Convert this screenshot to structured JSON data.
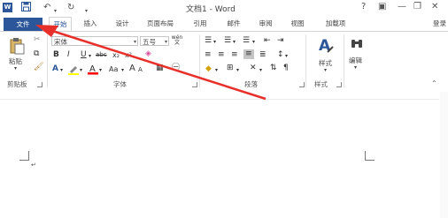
{
  "app": {
    "logo": "W",
    "title": "文档1 - Word"
  },
  "quick_access": {
    "save_icon": "save-icon",
    "undo_icon": "undo-icon",
    "redo_icon": "redo-icon",
    "customize_icon": "customize-qat-icon"
  },
  "window_controls": {
    "help": "?",
    "ribbon_display": "▣",
    "minimize": "—",
    "restore": "❐",
    "close": "✕"
  },
  "tabs": [
    {
      "label": "文件"
    },
    {
      "label": "开始"
    },
    {
      "label": "插入"
    },
    {
      "label": "设计"
    },
    {
      "label": "页面布局"
    },
    {
      "label": "引用"
    },
    {
      "label": "邮件"
    },
    {
      "label": "审阅"
    },
    {
      "label": "视图"
    },
    {
      "label": "加载项"
    }
  ],
  "login": "登录",
  "clipboard": {
    "paste_label": "粘贴",
    "group_label": "剪贴板"
  },
  "font": {
    "name": "宋体",
    "size": "五号",
    "group_label": "字体",
    "wen_glyph": "wén",
    "change_case": "Aa",
    "grow": "A",
    "shrink": "A"
  },
  "paragraph": {
    "group_label": "段落"
  },
  "styles": {
    "label": "样式",
    "group_label": "样式"
  },
  "editing": {
    "label": "编辑"
  },
  "document": {
    "paragraph_mark": "↵"
  },
  "colors": {
    "accent": "#2b579a",
    "arrow": "#e8302a",
    "text_highlight": "#ffff00",
    "font_color": "#ff0000"
  }
}
